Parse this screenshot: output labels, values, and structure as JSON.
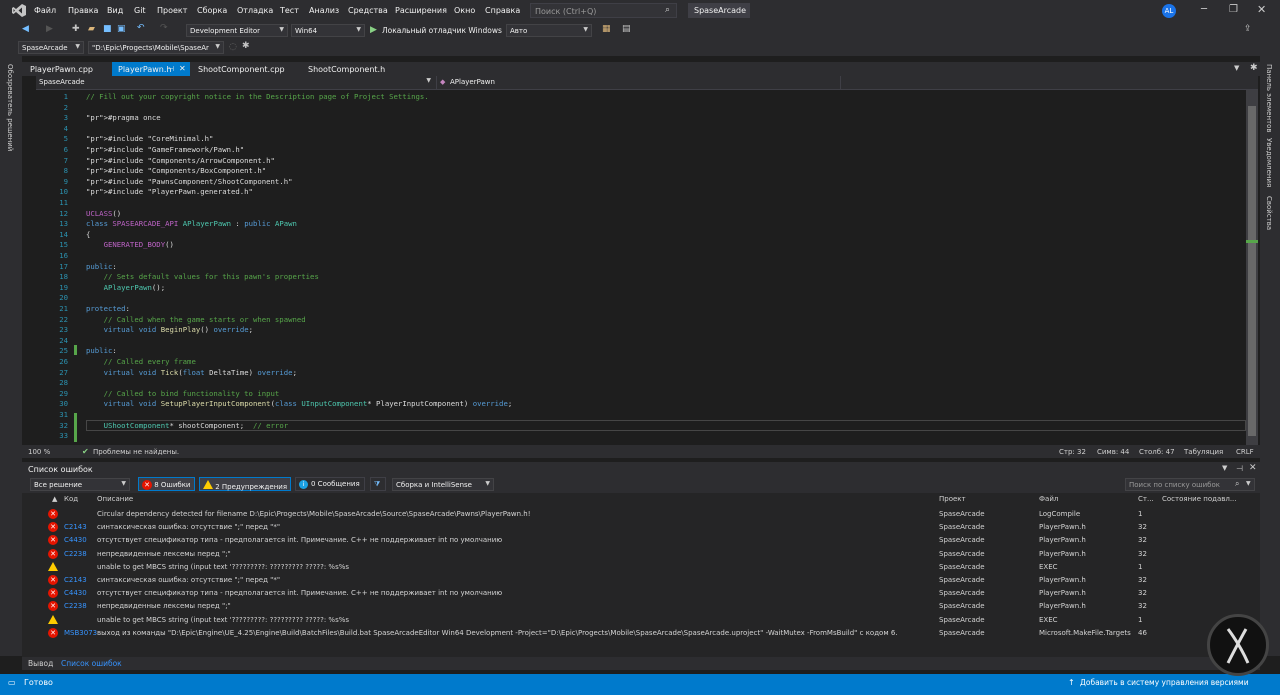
{
  "menu": {
    "items": [
      "Файл",
      "Правка",
      "Вид",
      "Git",
      "Проект",
      "Сборка",
      "Отладка",
      "Тест",
      "Анализ",
      "Средства",
      "Расширения",
      "Окно",
      "Справка"
    ],
    "search_placeholder": "Поиск (Ctrl+Q)",
    "solution_title": "SpaseArcade",
    "avatar": "AL"
  },
  "toolbar": {
    "config": "Development Editor",
    "platform": "Win64",
    "debugger": "Локальный отладчик Windows",
    "mode": "Авто",
    "project": "SpaseArcade",
    "path": "\"D:\\Epic\\Progects\\Mobile\\SpaseAr"
  },
  "side": {
    "left": "Обозреватель решений",
    "right": [
      "Панель элементов",
      "Уведомления",
      "Свойства"
    ]
  },
  "tabs": [
    {
      "label": "PlayerPawn.cpp",
      "active": false
    },
    {
      "label": "PlayerPawn.h",
      "active": true
    },
    {
      "label": "ShootComponent.cpp",
      "active": false
    },
    {
      "label": "ShootComponent.h",
      "active": false
    }
  ],
  "nav": {
    "project": "SpaseArcade",
    "member": "APlayerPawn"
  },
  "code_lines": [
    {
      "n": "1",
      "t": "// Fill out your copyright notice in the Description page of Project Settings."
    },
    {
      "n": "2",
      "t": ""
    },
    {
      "n": "3",
      "t": "#pragma once"
    },
    {
      "n": "4",
      "t": ""
    },
    {
      "n": "5",
      "t": "#include \"CoreMinimal.h\""
    },
    {
      "n": "6",
      "t": "#include \"GameFramework/Pawn.h\""
    },
    {
      "n": "7",
      "t": "#include \"Components/ArrowComponent.h\""
    },
    {
      "n": "8",
      "t": "#include \"Components/BoxComponent.h\""
    },
    {
      "n": "9",
      "t": "#include \"PawnsComponent/ShootComponent.h\""
    },
    {
      "n": "10",
      "t": "#include \"PlayerPawn.generated.h\""
    },
    {
      "n": "11",
      "t": ""
    },
    {
      "n": "12",
      "t": "UCLASS()"
    },
    {
      "n": "13",
      "t": "class SPASEARCADE_API APlayerPawn : public APawn"
    },
    {
      "n": "14",
      "t": "{"
    },
    {
      "n": "15",
      "t": "    GENERATED_BODY()"
    },
    {
      "n": "16",
      "t": ""
    },
    {
      "n": "17",
      "t": "public:"
    },
    {
      "n": "18",
      "t": "    // Sets default values for this pawn's properties"
    },
    {
      "n": "19",
      "t": "    APlayerPawn();"
    },
    {
      "n": "20",
      "t": ""
    },
    {
      "n": "21",
      "t": "protected:"
    },
    {
      "n": "22",
      "t": "    // Called when the game starts or when spawned"
    },
    {
      "n": "23",
      "t": "    virtual void BeginPlay() override;"
    },
    {
      "n": "24",
      "t": ""
    },
    {
      "n": "25",
      "t": "public:"
    },
    {
      "n": "26",
      "t": "    // Called every frame"
    },
    {
      "n": "27",
      "t": "    virtual void Tick(float DeltaTime) override;"
    },
    {
      "n": "28",
      "t": ""
    },
    {
      "n": "29",
      "t": "    // Called to bind functionality to input"
    },
    {
      "n": "30",
      "t": "    virtual void SetupPlayerInputComponent(class UInputComponent* PlayerInputComponent) override;"
    },
    {
      "n": "31",
      "t": ""
    },
    {
      "n": "32",
      "t": "    UShootComponent* shootComponent;  // error"
    },
    {
      "n": "33",
      "t": ""
    }
  ],
  "editor_status": {
    "zoom": "100 %",
    "problems": "Проблемы не найдены.",
    "line": "Стр: 32",
    "char": "Симв: 44",
    "col": "Столб: 47",
    "tabs": "Табуляция",
    "eol": "CRLF"
  },
  "errors_panel": {
    "title": "Список ошибок",
    "scope": "Все решение",
    "errors_btn": "8 Ошибки",
    "warnings_btn": "2 Предупреждения",
    "messages_btn": "0 Сообщения",
    "build_filter": "Сборка и IntelliSense",
    "search_placeholder": "Поиск по списку ошибок",
    "columns": [
      "Код",
      "Описание",
      "Проект",
      "Файл",
      "Ст...",
      "Состояние подавл..."
    ],
    "rows": [
      {
        "type": "error",
        "code": "",
        "desc": "Circular dependency detected for filename D:\\Epic\\Progects\\Mobile\\SpaseArcade\\Source\\SpaseArcade\\Pawns\\PlayerPawn.h!",
        "project": "SpaseArcade",
        "file": "LogCompile",
        "line": "1"
      },
      {
        "type": "error",
        "code": "C2143",
        "desc": "синтаксическая ошибка: отсутствие \";\" перед \"*\"",
        "project": "SpaseArcade",
        "file": "PlayerPawn.h",
        "line": "32"
      },
      {
        "type": "error",
        "code": "C4430",
        "desc": "отсутствует спецификатор типа - предполагается int. Примечание. C++ не поддерживает int по умолчанию",
        "project": "SpaseArcade",
        "file": "PlayerPawn.h",
        "line": "32"
      },
      {
        "type": "error",
        "code": "C2238",
        "desc": "непредвиденные лексемы перед \";\"",
        "project": "SpaseArcade",
        "file": "PlayerPawn.h",
        "line": "32"
      },
      {
        "type": "warning",
        "code": "",
        "desc": "unable to get MBCS string (input text '?????????: ????????? ?????: %s%s",
        "project": "SpaseArcade",
        "file": "EXEC",
        "line": "1"
      },
      {
        "type": "error",
        "code": "C2143",
        "desc": "синтаксическая ошибка: отсутствие \";\" перед \"*\"",
        "project": "SpaseArcade",
        "file": "PlayerPawn.h",
        "line": "32"
      },
      {
        "type": "error",
        "code": "C4430",
        "desc": "отсутствует спецификатор типа - предполагается int. Примечание. C++ не поддерживает int по умолчанию",
        "project": "SpaseArcade",
        "file": "PlayerPawn.h",
        "line": "32"
      },
      {
        "type": "error",
        "code": "C2238",
        "desc": "непредвиденные лексемы перед \";\"",
        "project": "SpaseArcade",
        "file": "PlayerPawn.h",
        "line": "32"
      },
      {
        "type": "warning",
        "code": "",
        "desc": "unable to get MBCS string (input text '?????????: ????????? ?????: %s%s",
        "project": "SpaseArcade",
        "file": "EXEC",
        "line": "1"
      },
      {
        "type": "error",
        "code": "MSB3073",
        "desc": "выход из команды \"D:\\Epic\\Engine\\UE_4.25\\Engine\\Build\\BatchFiles\\Build.bat SpaseArcadeEditor Win64 Development -Project=\"D:\\Epic\\Progects\\Mobile\\SpaseArcade\\SpaseArcade.uproject\" -WaitMutex -FromMsBuild\" с кодом 6.",
        "project": "SpaseArcade",
        "file": "Microsoft.MakeFile.Targets",
        "line": "46"
      }
    ]
  },
  "bottom_tabs": [
    "Вывод",
    "Список ошибок"
  ],
  "status": {
    "ready": "Готово",
    "vcs": "Добавить в систему управления версиями"
  }
}
